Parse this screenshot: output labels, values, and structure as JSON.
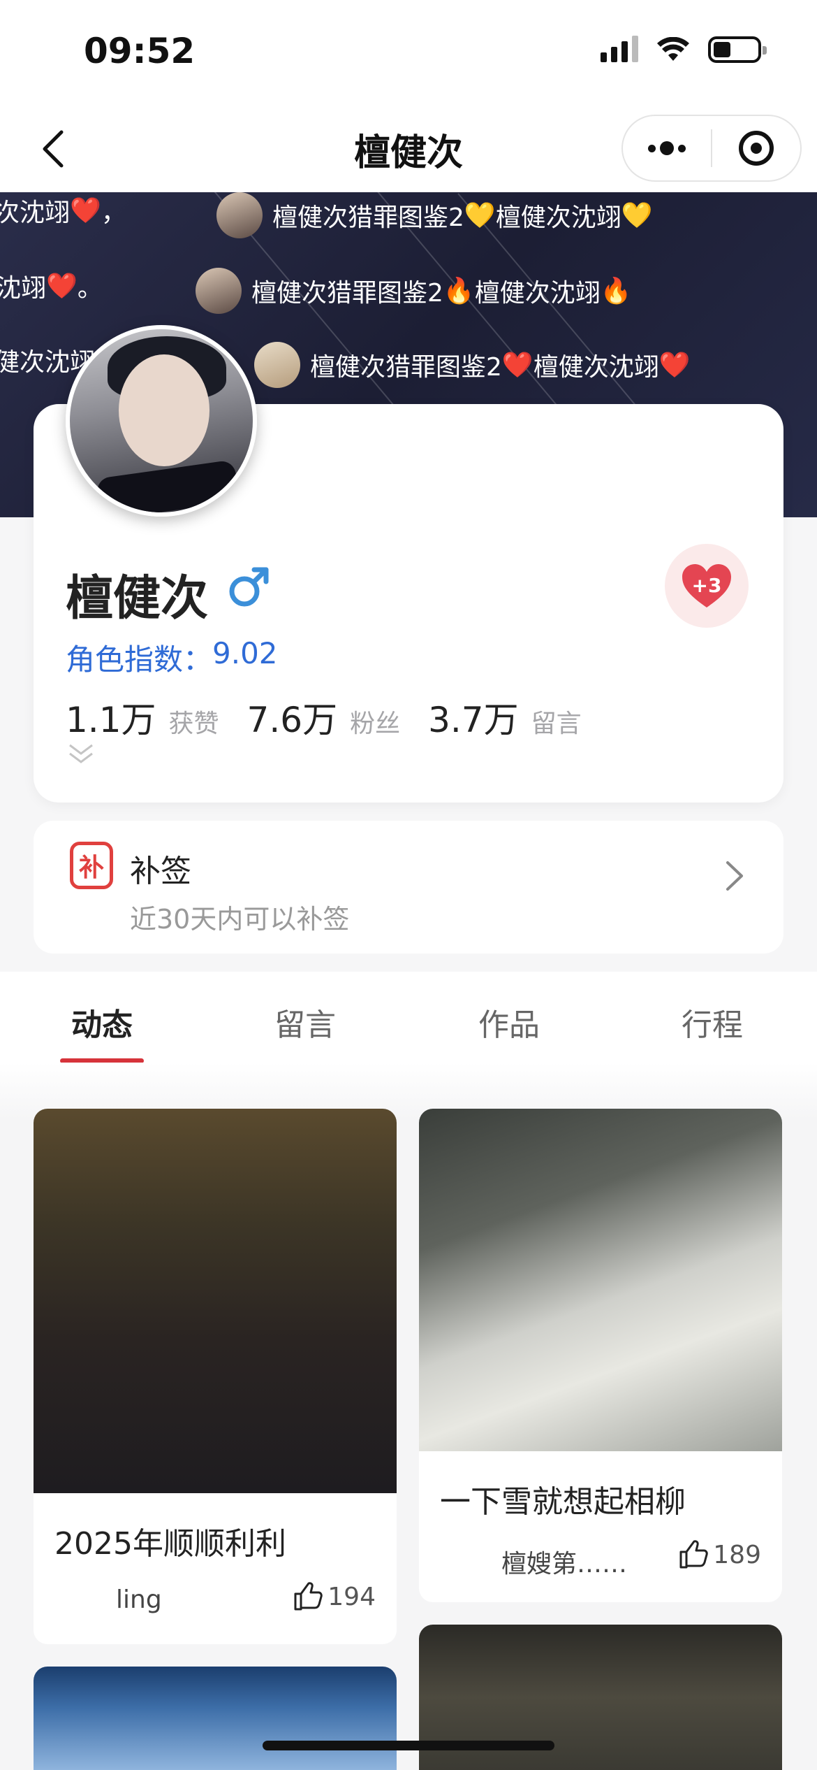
{
  "status_bar": {
    "time": "09:52"
  },
  "nav": {
    "title": "檀健次"
  },
  "banner": {
    "barrage": [
      {
        "text": "次沈翊",
        "emoji": "❤️",
        "tail": "，"
      },
      {
        "text": "檀健次猎罪图鉴2",
        "emoji": "💛",
        "text2": "檀健次沈翊",
        "emoji2": "💛"
      },
      {
        "text": "沈翊",
        "emoji": "❤️",
        "tail": "。"
      },
      {
        "text": "檀健次猎罪图鉴2",
        "emoji": "🔥",
        "text2": "檀健次沈翊",
        "emoji2": "🔥"
      },
      {
        "text": "健次沈翊"
      },
      {
        "text": "檀健次猎罪图鉴2",
        "emoji": "❤️",
        "text2": "檀健次沈翊",
        "emoji2": "❤️"
      }
    ]
  },
  "profile": {
    "name": "檀健次",
    "gender_icon": "male-icon",
    "role_index_label": "角色指数：",
    "role_index_value": "9.02",
    "stats": [
      {
        "num": "1.1万",
        "label": "获赞"
      },
      {
        "num": "7.6万",
        "label": "粉丝"
      },
      {
        "num": "3.7万",
        "label": "留言"
      }
    ],
    "like_badge": "+3"
  },
  "checkin": {
    "icon_char": "补",
    "title": "补签",
    "subtitle": "近30天内可以补签"
  },
  "tabs": [
    {
      "label": "动态",
      "active": true
    },
    {
      "label": "留言",
      "active": false
    },
    {
      "label": "作品",
      "active": false
    },
    {
      "label": "行程",
      "active": false
    }
  ],
  "cards": [
    {
      "title": "2025年顺顺利利",
      "author": "ling",
      "likes": "194"
    },
    {
      "title": "一下雪就想起相柳",
      "author": "檀嫂第……",
      "likes": "189"
    }
  ],
  "colors": {
    "accent": "#d6333a",
    "link_blue": "#2f6bd6",
    "male_blue": "#3b8fd9"
  }
}
